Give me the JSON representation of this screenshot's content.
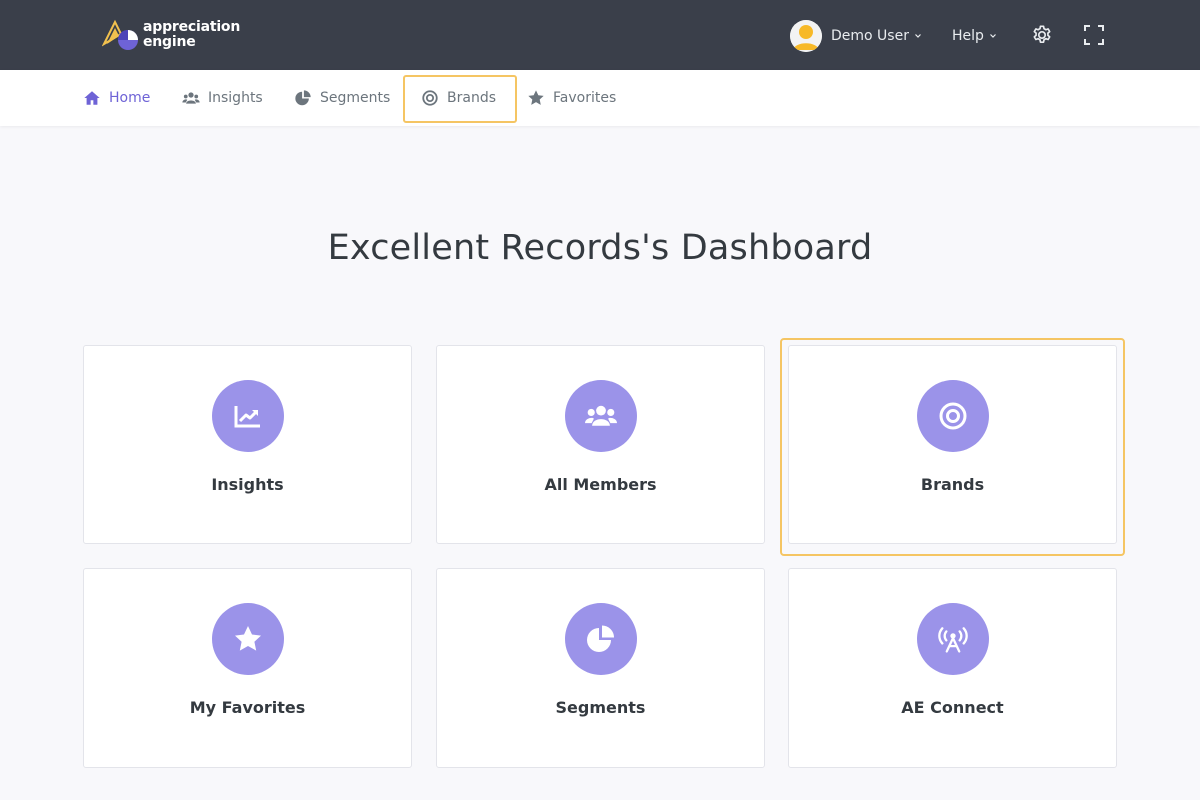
{
  "brand": {
    "line1": "appreciation",
    "line2": "engine"
  },
  "header": {
    "user_name": "Demo User",
    "help_label": "Help",
    "settings_icon": "gear-icon",
    "fullscreen_icon": "fullscreen-icon"
  },
  "nav": {
    "items": [
      {
        "label": "Home",
        "icon": "home-icon",
        "active": true
      },
      {
        "label": "Insights",
        "icon": "users-icon"
      },
      {
        "label": "Segments",
        "icon": "pie-chart-icon"
      },
      {
        "label": "Brands",
        "icon": "target-icon",
        "highlighted": true
      },
      {
        "label": "Favorites",
        "icon": "star-icon"
      }
    ]
  },
  "page": {
    "title": "Excellent Records's Dashboard"
  },
  "cards": [
    {
      "label": "Insights",
      "icon": "chart-line-icon"
    },
    {
      "label": "All Members",
      "icon": "users-icon"
    },
    {
      "label": "Brands",
      "icon": "target-icon",
      "highlighted": true
    },
    {
      "label": "My Favorites",
      "icon": "star-icon"
    },
    {
      "label": "Segments",
      "icon": "pie-chart-icon"
    },
    {
      "label": "AE Connect",
      "icon": "broadcast-tower-icon"
    }
  ],
  "colors": {
    "topbar": "#3a3f4a",
    "accent": "#6e63d6",
    "icon_circle": "#9b93e9",
    "highlight": "#f5c563"
  }
}
